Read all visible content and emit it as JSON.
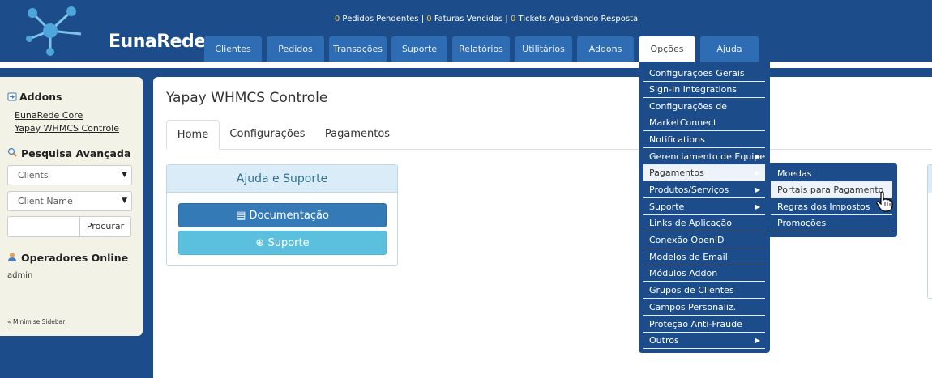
{
  "header": {
    "logo_text": "EunaRede",
    "status": {
      "pending_orders_count": "0",
      "pending_orders_label": "Pedidos Pendentes",
      "overdue_invoices_count": "0",
      "overdue_invoices_label": "Faturas Vencidas",
      "tickets_count": "0",
      "tickets_label": "Tickets Aguardando Resposta"
    }
  },
  "nav": {
    "tabs": [
      "Clientes",
      "Pedidos",
      "Transações",
      "Suporte",
      "Relatórios",
      "Utilitários",
      "Addons",
      "Opções",
      "Ajuda"
    ]
  },
  "sidebar": {
    "addons_title": "Addons",
    "addons_links": [
      "EunaRede Core",
      "Yapay WHMCS Controle"
    ],
    "search_title": "Pesquisa Avançada",
    "select_type": "Clients",
    "select_field": "Client Name",
    "search_button": "Procurar",
    "online_title": "Operadores Online",
    "online_user": "admin",
    "minimise": "« Minimise Sidebar"
  },
  "content": {
    "page_title": "Yapay WHMCS Controle",
    "tabs": [
      "Home",
      "Configurações",
      "Pagamentos"
    ],
    "help_title": "Ajuda e Suporte",
    "doc_button": "Documentação",
    "support_button": "Suporte"
  },
  "menu": {
    "items": [
      "Configurações Gerais",
      "Sign-In Integrations",
      "Configurações de",
      "MarketConnect",
      "Notifications",
      "Gerenciamento de Equipe",
      "Pagamentos",
      "Produtos/Serviços",
      "Suporte",
      "Links de Aplicação",
      "Conexão OpenID",
      "Modelos de Email",
      "Módulos Addon",
      "Grupos de Clientes",
      "Campos Personaliz.",
      "Proteção Anti-Fraude",
      "Outros"
    ],
    "submenu": [
      "Moedas",
      "Portais para Pagamento",
      "Regras dos Impostos",
      "Promoções"
    ]
  },
  "colors": {
    "header_bg": "#1c4d8a",
    "tab_bg": "#2e6db4",
    "count_highlight": "#f5c342",
    "primary_button": "#337ab7",
    "info_button": "#5bc0de"
  },
  "icons": {
    "logo": "network-nodes-icon",
    "addons": "puzzle-icon",
    "search": "magnifier-icon",
    "operators": "user-icon",
    "documentation": "book-icon",
    "support": "lifebuoy-icon",
    "cursor": "hand-pointer-icon"
  }
}
